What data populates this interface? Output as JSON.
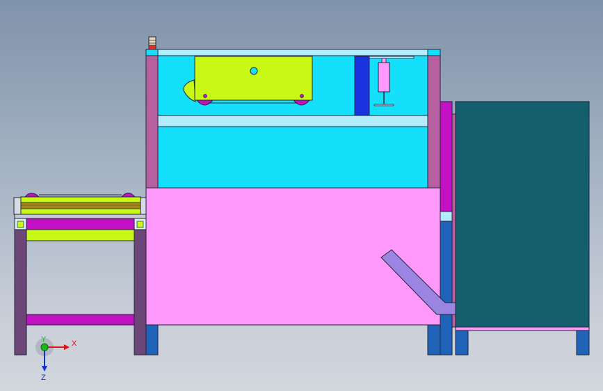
{
  "viewport": {
    "background_top": "#7f93ab",
    "background_bottom": "#d2d6dd"
  },
  "colors": {
    "cyan_panel": "#15e0fb",
    "light_cyan": "#b2ecfb",
    "pink_panel": "#fe99fb",
    "mauve_post": "#b7609f",
    "purple_leg": "#6b4677",
    "yellow_green": "#c8f916",
    "magenta": "#c211c2",
    "blue_leg": "#1f64b8",
    "dark_teal": "#155e6e",
    "chute": "#9a86e2",
    "olive_roller": "#a7861e",
    "blue_block": "#1a33e0",
    "outline": "#20243a"
  },
  "triad": {
    "x_label": "X",
    "y_label": "Y",
    "z_label": "Z",
    "x_color": "#e01010",
    "y_color": "#18b818",
    "z_color": "#1030d8"
  }
}
